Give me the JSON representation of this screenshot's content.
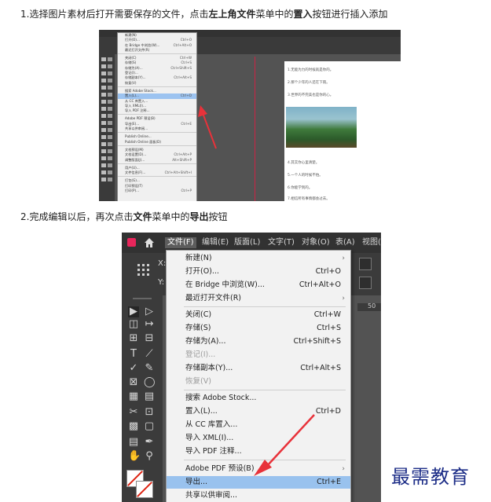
{
  "steps": {
    "step1": {
      "prefix": "1.选择图片素材后打开需要保存的文件，点击",
      "b1": "左上角文件",
      "mid": "菜单中的",
      "b2": "置入",
      "suffix": "按钮进行插入添加"
    },
    "step2": {
      "prefix": "2.完成编辑以后，再次点击",
      "b1": "文件",
      "mid": "菜单中的",
      "b2": "导出",
      "suffix": "按钮"
    }
  },
  "screenshot1": {
    "menu_items": [
      {
        "label": "新建(N)",
        "shortcut": ""
      },
      {
        "label": "打开(O)...",
        "shortcut": "Ctrl+O"
      },
      {
        "label": "在 Bridge 中浏览(W)...",
        "shortcut": "Ctrl+Alt+O"
      },
      {
        "label": "最近打开文件(R)",
        "shortcut": ""
      },
      {
        "sep": true
      },
      {
        "label": "关闭(C)",
        "shortcut": "Ctrl+W"
      },
      {
        "label": "存储(S)",
        "shortcut": "Ctrl+S"
      },
      {
        "label": "存储为(A)...",
        "shortcut": "Ctrl+Shift+S"
      },
      {
        "label": "登记(I)...",
        "shortcut": ""
      },
      {
        "label": "存储副本(Y)...",
        "shortcut": "Ctrl+Alt+S"
      },
      {
        "label": "恢复(V)",
        "shortcut": ""
      },
      {
        "sep": true
      },
      {
        "label": "搜索 Adobe Stock...",
        "shortcut": ""
      },
      {
        "label": "置入(L)...",
        "shortcut": "Ctrl+D",
        "highlight": true
      },
      {
        "label": "从 CC 库置入...",
        "shortcut": ""
      },
      {
        "label": "导入 XML(I)...",
        "shortcut": ""
      },
      {
        "label": "导入 PDF 注释...",
        "shortcut": ""
      },
      {
        "sep": true
      },
      {
        "label": "Adobe PDF 预设(B)",
        "shortcut": ""
      },
      {
        "label": "导出(E)...",
        "shortcut": "Ctrl+E"
      },
      {
        "label": "共享以供审阅...",
        "shortcut": ""
      },
      {
        "sep": true
      },
      {
        "label": "Publish Online...",
        "shortcut": ""
      },
      {
        "label": "Publish Online 面板(D)",
        "shortcut": ""
      },
      {
        "sep": true
      },
      {
        "label": "文档预设(M)",
        "shortcut": ""
      },
      {
        "label": "文档设置(D)...",
        "shortcut": "Ctrl+Alt+P"
      },
      {
        "label": "调整版面(J)...",
        "shortcut": "Alt+Shift+P"
      },
      {
        "sep": true
      },
      {
        "label": "用户(U)...",
        "shortcut": ""
      },
      {
        "label": "文件信息(F)...",
        "shortcut": "Ctrl+Alt+Shift+I"
      },
      {
        "sep": true
      },
      {
        "label": "打包(G)...",
        "shortcut": ""
      },
      {
        "label": "打印预设(T)",
        "shortcut": ""
      },
      {
        "label": "打印(P)...",
        "shortcut": "Ctrl+P"
      }
    ],
    "page_lines": [
      "1.无能为力的时候就是你的。",
      "2.那个少年的人还在下雨。",
      "3.世界的不完美也是你的心。",
      "4.其实你心里清楚。",
      "5.一个人的时候不怕。",
      "6.你能学到的。",
      "7.相信所有事情都会过去。"
    ]
  },
  "screenshot2": {
    "menubar": {
      "file": "文件(F)",
      "edit": "编辑(E)",
      "layout": "版面(L)",
      "type": "文字(T)",
      "object": "对象(O)",
      "table": "表(A)",
      "view": "视图("
    },
    "ctrl": {
      "x": "X:",
      "y": "Y:",
      "ruler_num": "50"
    },
    "menu": [
      {
        "label": "新建(N)",
        "shortcut": "",
        "submenu": true,
        "disabled": false
      },
      {
        "label": "打开(O)...",
        "shortcut": "Ctrl+O",
        "submenu": false,
        "disabled": false
      },
      {
        "label": "在 Bridge 中浏览(W)...",
        "shortcut": "Ctrl+Alt+O",
        "submenu": false,
        "disabled": false
      },
      {
        "label": "最近打开文件(R)",
        "shortcut": "",
        "submenu": true,
        "disabled": false
      },
      {
        "label": "关闭(C)",
        "shortcut": "Ctrl+W",
        "submenu": false,
        "disabled": false
      },
      {
        "label": "存储(S)",
        "shortcut": "Ctrl+S",
        "submenu": false,
        "disabled": false
      },
      {
        "label": "存储为(A)...",
        "shortcut": "Ctrl+Shift+S",
        "submenu": false,
        "disabled": false
      },
      {
        "label": "登记(I)...",
        "shortcut": "",
        "submenu": false,
        "disabled": true
      },
      {
        "label": "存储副本(Y)...",
        "shortcut": "Ctrl+Alt+S",
        "submenu": false,
        "disabled": false
      },
      {
        "label": "恢复(V)",
        "shortcut": "",
        "submenu": false,
        "disabled": true
      },
      {
        "label": "搜索 Adobe Stock...",
        "shortcut": "",
        "submenu": false,
        "disabled": false
      },
      {
        "label": "置入(L)...",
        "shortcut": "Ctrl+D",
        "submenu": false,
        "disabled": false
      },
      {
        "label": "从 CC 库置入...",
        "shortcut": "",
        "submenu": false,
        "disabled": false
      },
      {
        "label": "导入 XML(I)...",
        "shortcut": "",
        "submenu": false,
        "disabled": false
      },
      {
        "label": "导入 PDF 注释...",
        "shortcut": "",
        "submenu": false,
        "disabled": false
      },
      {
        "label": "Adobe PDF 预设(B)",
        "shortcut": "",
        "submenu": true,
        "disabled": false
      },
      {
        "label": "导出...",
        "shortcut": "Ctrl+E",
        "submenu": false,
        "disabled": false,
        "highlight": true
      },
      {
        "label": "共享以供审阅...",
        "shortcut": "",
        "submenu": false,
        "disabled": false
      }
    ]
  },
  "watermark": "最需教育",
  "colors": {
    "highlight": "#99c2ee",
    "arrow": "#e8323a",
    "watermark": "#1c2d87"
  }
}
